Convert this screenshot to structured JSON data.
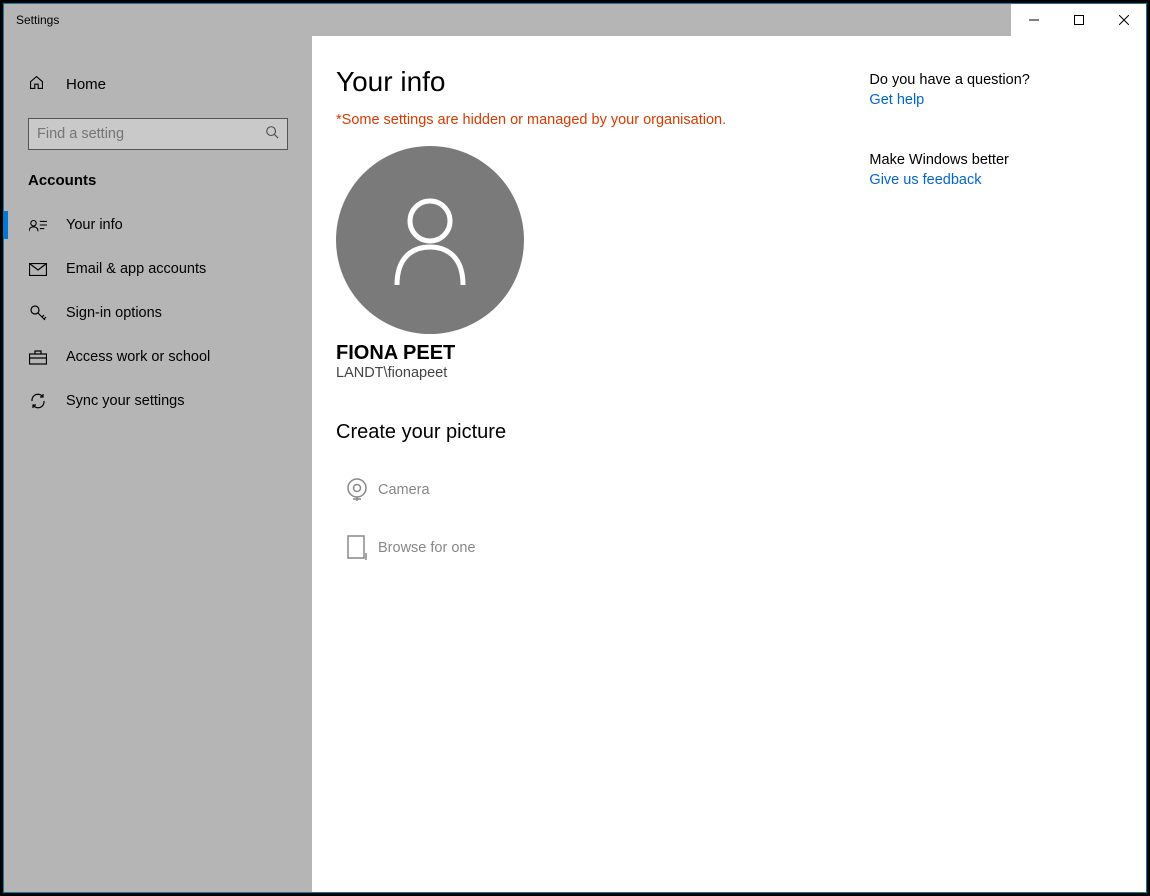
{
  "window": {
    "title": "Settings"
  },
  "sidebar": {
    "home": "Home",
    "search_placeholder": "Find a setting",
    "section": "Accounts",
    "items": [
      {
        "label": "Your info"
      },
      {
        "label": "Email & app accounts"
      },
      {
        "label": "Sign-in options"
      },
      {
        "label": "Access work or school"
      },
      {
        "label": "Sync your settings"
      }
    ]
  },
  "page": {
    "title": "Your info",
    "warning": "*Some settings are hidden or managed by your organisation.",
    "user_name": "FIONA PEET",
    "user_account": "LANDT\\fionapeet",
    "picture_heading": "Create your picture",
    "options": {
      "camera": "Camera",
      "browse": "Browse for one"
    }
  },
  "help": {
    "q1": "Do you have a question?",
    "link1": "Get help",
    "q2": "Make Windows better",
    "link2": "Give us feedback"
  }
}
